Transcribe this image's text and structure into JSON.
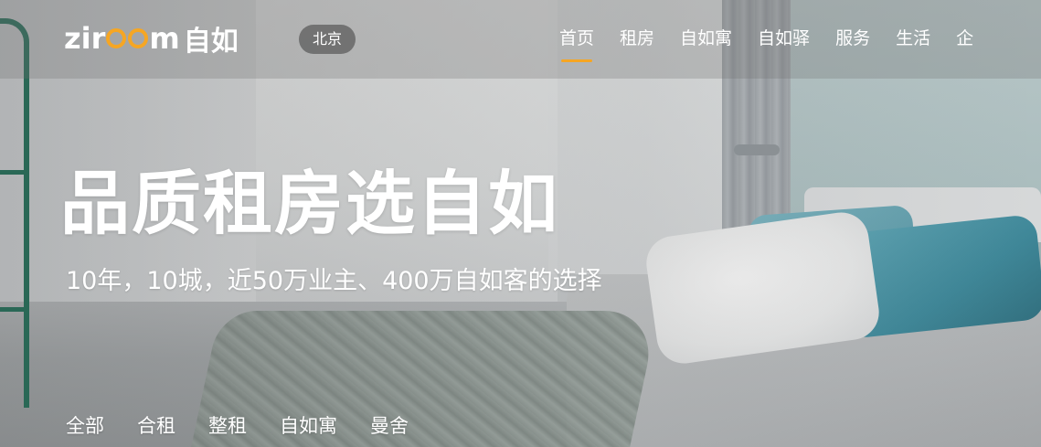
{
  "header": {
    "logo_text_prefix": "zir",
    "logo_text_suffix": "m",
    "logo_text_cn": "自如",
    "city": "北京",
    "nav": [
      {
        "label": "首页",
        "active": true
      },
      {
        "label": "租房",
        "active": false
      },
      {
        "label": "自如寓",
        "active": false
      },
      {
        "label": "自如驿",
        "active": false
      },
      {
        "label": "服务",
        "active": false
      },
      {
        "label": "生活",
        "active": false
      },
      {
        "label": "企",
        "active": false
      }
    ]
  },
  "hero": {
    "title": "品质租房选自如",
    "subtitle": "10年，10城，近50万业主、400万自如客的选择"
  },
  "search": {
    "tabs": [
      {
        "label": "全部"
      },
      {
        "label": "合租"
      },
      {
        "label": "整租"
      },
      {
        "label": "自如寓"
      },
      {
        "label": "曼舍"
      }
    ]
  },
  "colors": {
    "accent": "#f6a623",
    "text": "#ffffff",
    "ladder": "#1f6f58",
    "pillow_blue": "#3f8798"
  }
}
